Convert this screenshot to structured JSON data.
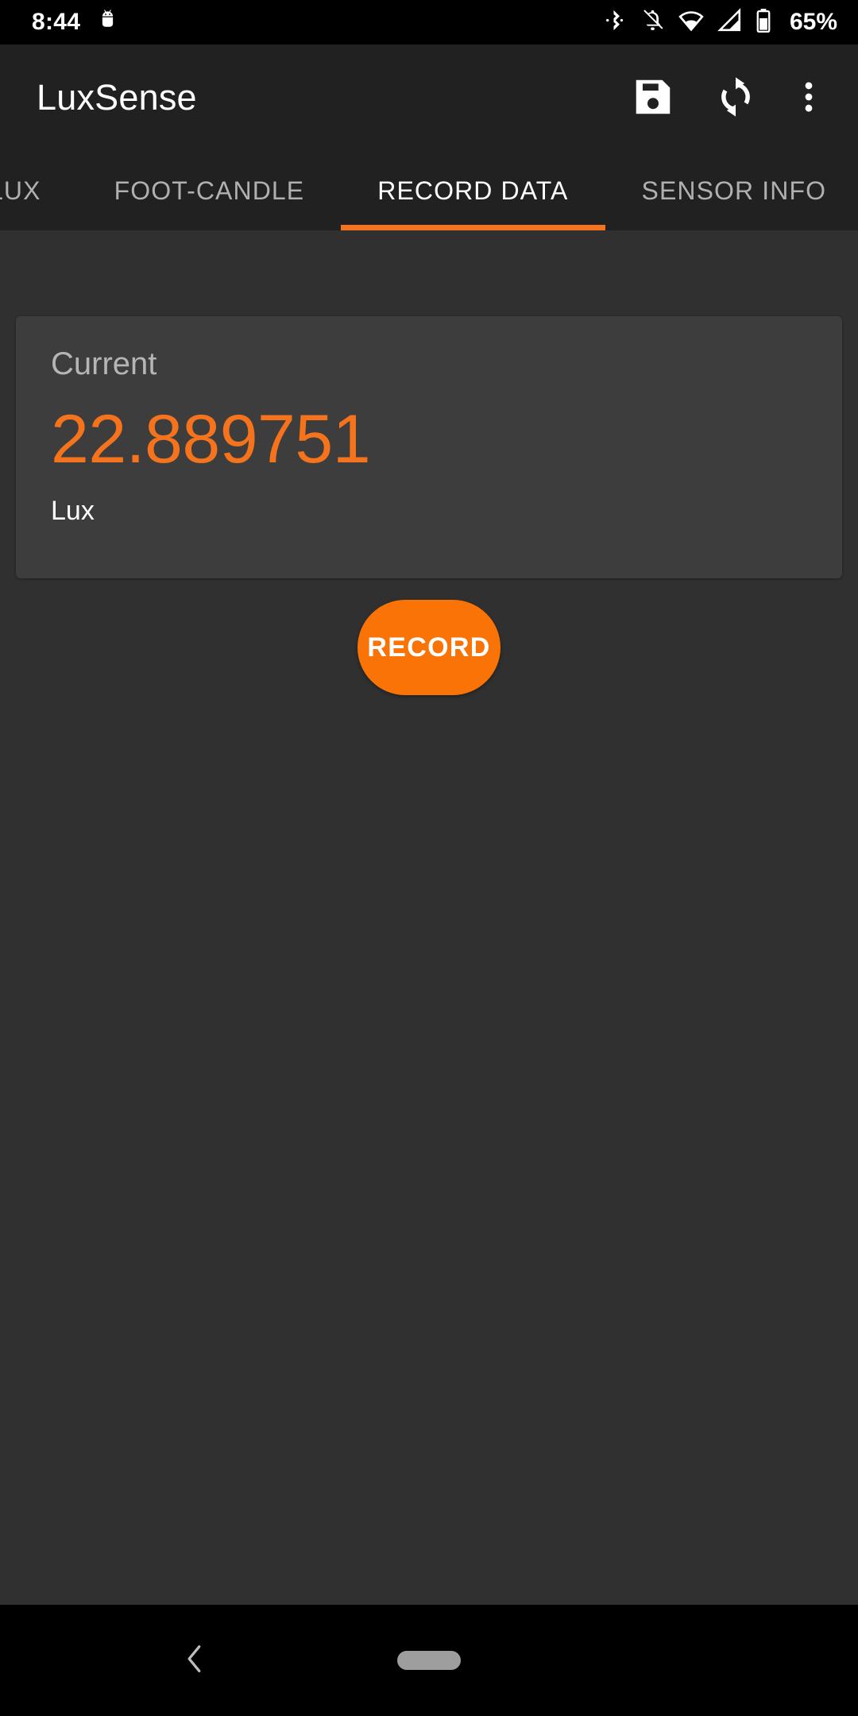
{
  "status_bar": {
    "time": "8:44",
    "battery_percent": "65%",
    "icons": [
      {
        "name": "android-head-icon",
        "position": "left"
      },
      {
        "name": "bluetooth-icon",
        "position": "right"
      },
      {
        "name": "notifications-off-icon",
        "position": "right"
      },
      {
        "name": "wifi-icon",
        "position": "right"
      },
      {
        "name": "cell-signal-icon",
        "position": "right"
      },
      {
        "name": "battery-icon",
        "position": "right"
      }
    ]
  },
  "app_bar": {
    "title": "LuxSense",
    "actions": [
      {
        "name": "save-icon",
        "label": "Save"
      },
      {
        "name": "refresh-icon",
        "label": "Refresh"
      },
      {
        "name": "overflow-menu-icon",
        "label": "More options"
      }
    ]
  },
  "tabs": {
    "active_index": 2,
    "items": [
      {
        "label": "LUX",
        "active": false
      },
      {
        "label": "FOOT-CANDLE",
        "active": false
      },
      {
        "label": "RECORD DATA",
        "active": true
      },
      {
        "label": "SENSOR INFO",
        "active": false
      }
    ]
  },
  "reading_card": {
    "label": "Current",
    "value": "22.889751",
    "unit": "Lux"
  },
  "record_button": {
    "label": "RECORD"
  },
  "navigation_bar": {
    "back_label": "Back",
    "home_label": "Home"
  },
  "colors": {
    "accent": "#f4731c",
    "record_button": "#f97306",
    "app_bar_bg": "#212121",
    "page_bg": "#303030",
    "card_bg": "#3d3d3d",
    "status_bar_bg": "#000000",
    "active_tab_text": "#ffffff",
    "inactive_tab_text": "#b0b0b0"
  }
}
